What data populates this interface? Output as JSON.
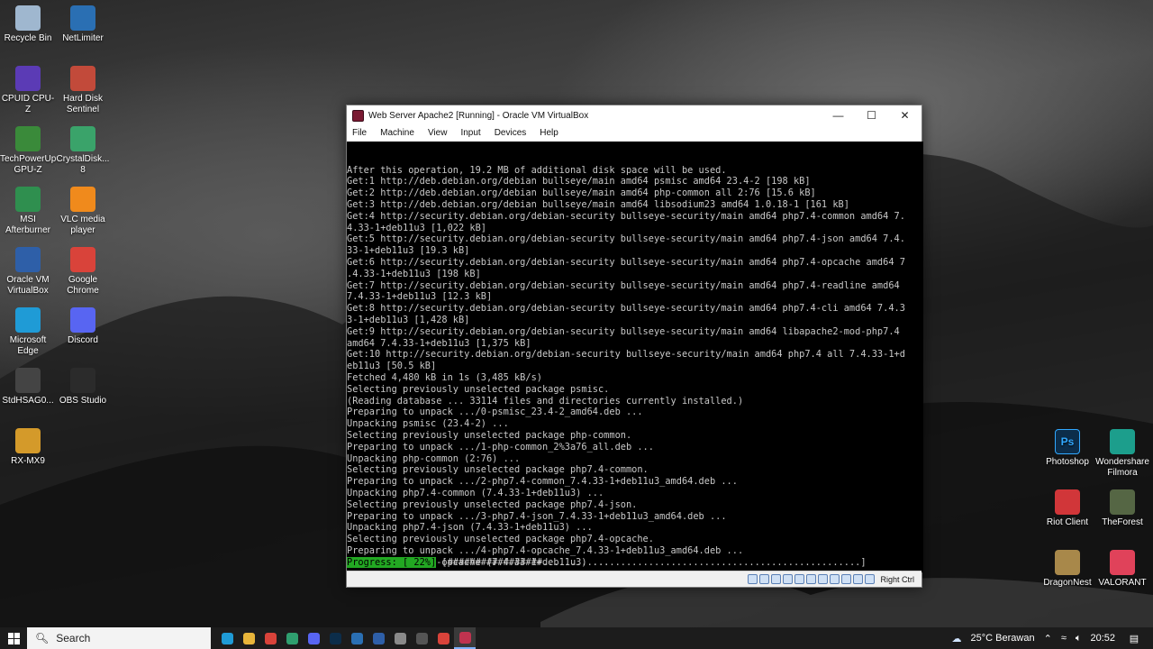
{
  "desktop": {
    "left_icons": [
      {
        "label": "Recycle Bin",
        "icon": "recycle-bin-icon",
        "color": "#9fb7cf"
      },
      {
        "label": "NetLimiter",
        "icon": "netlimiter-icon",
        "color": "#2a6fb3"
      },
      {
        "label": "CPUID CPU-Z",
        "icon": "cpuz-icon",
        "color": "#5b3bb5"
      },
      {
        "label": "Hard Disk Sentinel",
        "icon": "hard-disk-sentinel-icon",
        "color": "#c24a3a"
      },
      {
        "label": "TechPowerUp GPU-Z",
        "icon": "gpuz-icon",
        "color": "#3a8a3a"
      },
      {
        "label": "CrystalDisk... 8",
        "icon": "crystaldisk-icon",
        "color": "#3aa36a"
      },
      {
        "label": "MSI Afterburner",
        "icon": "msi-afterburner-icon",
        "color": "#2f8f4f"
      },
      {
        "label": "VLC media player",
        "icon": "vlc-icon",
        "color": "#f08a1c"
      },
      {
        "label": "Oracle VM VirtualBox",
        "icon": "virtualbox-icon",
        "color": "#2e5fa8"
      },
      {
        "label": "Google Chrome",
        "icon": "chrome-icon",
        "color": "#d9433a"
      },
      {
        "label": "Microsoft Edge",
        "icon": "edge-icon",
        "color": "#1f9bd6"
      },
      {
        "label": "Discord",
        "icon": "discord-icon",
        "color": "#5865f2"
      },
      {
        "label": "StdHSAG0...",
        "icon": "stdhsag-icon",
        "color": "#444444"
      },
      {
        "label": "OBS Studio",
        "icon": "obs-icon",
        "color": "#2b2b2b"
      },
      {
        "label": "RX-MX9",
        "icon": "rx-mx9-icon",
        "color": "#d49a2a"
      }
    ],
    "right_icons": [
      {
        "label": "Photoshop",
        "icon": "photoshop-icon",
        "color": "#0c2d4a",
        "glyph": "Ps"
      },
      {
        "label": "Wondershare Filmora",
        "icon": "filmora-icon",
        "color": "#1c9e8c",
        "glyph": ""
      },
      {
        "label": "Riot Client",
        "icon": "riot-client-icon",
        "color": "#d13639",
        "glyph": ""
      },
      {
        "label": "TheForest",
        "icon": "theforest-icon",
        "color": "#556644",
        "glyph": ""
      },
      {
        "label": "DragonNest",
        "icon": "dragonnest-icon",
        "color": "#a8884a",
        "glyph": ""
      },
      {
        "label": "VALORANT",
        "icon": "valorant-icon",
        "color": "#e0425a",
        "glyph": ""
      }
    ]
  },
  "window": {
    "title": "Web Server Apache2 [Running] - Oracle VM VirtualBox",
    "controls": {
      "minimize": "—",
      "maximize": "☐",
      "close": "✕"
    },
    "menu": [
      "File",
      "Machine",
      "View",
      "Input",
      "Devices",
      "Help"
    ],
    "terminal_lines": [
      "After this operation, 19.2 MB of additional disk space will be used.",
      "Get:1 http://deb.debian.org/debian bullseye/main amd64 psmisc amd64 23.4-2 [198 kB]",
      "Get:2 http://deb.debian.org/debian bullseye/main amd64 php-common all 2:76 [15.6 kB]",
      "Get:3 http://deb.debian.org/debian bullseye/main amd64 libsodium23 amd64 1.0.18-1 [161 kB]",
      "Get:4 http://security.debian.org/debian-security bullseye-security/main amd64 php7.4-common amd64 7.",
      "4.33-1+deb11u3 [1,022 kB]",
      "Get:5 http://security.debian.org/debian-security bullseye-security/main amd64 php7.4-json amd64 7.4.",
      "33-1+deb11u3 [19.3 kB]",
      "Get:6 http://security.debian.org/debian-security bullseye-security/main amd64 php7.4-opcache amd64 7",
      ".4.33-1+deb11u3 [198 kB]",
      "Get:7 http://security.debian.org/debian-security bullseye-security/main amd64 php7.4-readline amd64",
      "7.4.33-1+deb11u3 [12.3 kB]",
      "Get:8 http://security.debian.org/debian-security bullseye-security/main amd64 php7.4-cli amd64 7.4.3",
      "3-1+deb11u3 [1,428 kB]",
      "Get:9 http://security.debian.org/debian-security bullseye-security/main amd64 libapache2-mod-php7.4",
      "amd64 7.4.33-1+deb11u3 [1,375 kB]",
      "Get:10 http://security.debian.org/debian-security bullseye-security/main amd64 php7.4 all 7.4.33-1+d",
      "eb11u3 [50.5 kB]",
      "Fetched 4,480 kB in 1s (3,485 kB/s)",
      "Selecting previously unselected package psmisc.",
      "(Reading database ... 33114 files and directories currently installed.)",
      "Preparing to unpack .../0-psmisc_23.4-2_amd64.deb ...",
      "Unpacking psmisc (23.4-2) ...",
      "Selecting previously unselected package php-common.",
      "Preparing to unpack .../1-php-common_2%3a76_all.deb ...",
      "Unpacking php-common (2:76) ...",
      "Selecting previously unselected package php7.4-common.",
      "Preparing to unpack .../2-php7.4-common_7.4.33-1+deb11u3_amd64.deb ...",
      "Unpacking php7.4-common (7.4.33-1+deb11u3) ...",
      "Selecting previously unselected package php7.4-json.",
      "Preparing to unpack .../3-php7.4-json_7.4.33-1+deb11u3_amd64.deb ...",
      "Unpacking php7.4-json (7.4.33-1+deb11u3) ...",
      "Selecting previously unselected package php7.4-opcache.",
      "Preparing to unpack .../4-php7.4-opcache_7.4.33-1+deb11u3_amd64.deb ...",
      "Unpacking php7.4-opcache (7.4.33-1+deb11u3) ..."
    ],
    "progress": {
      "label": "Progress: [ 22%]",
      "bar": "[#################.........................................................]",
      "percent": 22,
      "color": "#22a822"
    },
    "status_icons": [
      "hdd-icon",
      "optical-icon",
      "audio-icon",
      "network-icon",
      "usb-icon",
      "shared-folder-icon",
      "display-icon",
      "recording-icon",
      "cpu-icon",
      "mouse-integration-icon",
      "keyboard-icon"
    ],
    "host_key": "Right Ctrl"
  },
  "taskbar": {
    "search_placeholder": "Search",
    "apps": [
      {
        "icon": "edge-icon",
        "color": "#1f9bd6",
        "active": false
      },
      {
        "icon": "file-explorer-icon",
        "color": "#e8b53a",
        "active": false
      },
      {
        "icon": "chrome-icon",
        "color": "#d9433a",
        "active": false
      },
      {
        "icon": "terminal-icon",
        "color": "#2f9f6f",
        "active": false
      },
      {
        "icon": "discord-icon",
        "color": "#5865f2",
        "active": false
      },
      {
        "icon": "photoshop-icon",
        "color": "#0c2d4a",
        "active": false
      },
      {
        "icon": "netlimiter-icon",
        "color": "#2a6fb3",
        "active": false
      },
      {
        "icon": "virtualbox-icon",
        "color": "#2e5fa8",
        "active": false
      },
      {
        "icon": "network-drive-icon",
        "color": "#8a8a8a",
        "active": false
      },
      {
        "icon": "obs-icon",
        "color": "#555555",
        "active": false
      },
      {
        "icon": "chrome-icon",
        "color": "#d9433a",
        "active": false
      },
      {
        "icon": "virtualbox-vm-icon",
        "color": "#c0334f",
        "active": true
      }
    ],
    "weather": "25°C  Berawan",
    "clock": "20:52",
    "accent": "#7fb2ff"
  }
}
